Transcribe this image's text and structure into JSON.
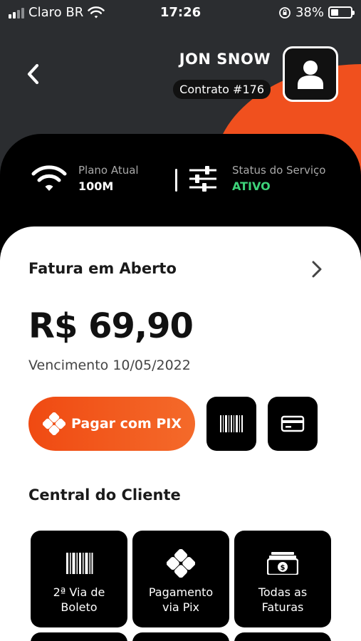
{
  "status_bar": {
    "carrier": "Claro BR",
    "time": "17:26",
    "battery": "38%",
    "battery_level": 0.38
  },
  "header": {
    "user_name": "JON SNOW",
    "contract": "Contrato #176",
    "back_icon": "chevron-left-icon",
    "avatar_icon": "user-icon"
  },
  "info": {
    "plan_label": "Plano Atual",
    "plan_value": "100M",
    "status_label": "Status do Serviço",
    "status_value": "ATIVO"
  },
  "invoice": {
    "title": "Fatura em Aberto",
    "amount": "R$ 69,90",
    "due": "Vencimento 10/05/2022",
    "pix_button": "Pagar com PIX"
  },
  "central": {
    "title": "Central do Cliente",
    "tiles": [
      {
        "label": "2ª Via de\nBoleto",
        "icon": "barcode-icon"
      },
      {
        "label": "Pagamento\nvia Pix",
        "icon": "pix-icon"
      },
      {
        "label": "Todas as\nFaturas",
        "icon": "money-icon"
      }
    ]
  },
  "colors": {
    "accent": "#f04a12",
    "active": "#3ed37a",
    "dark": "#000000",
    "header": "#2b2d30"
  }
}
